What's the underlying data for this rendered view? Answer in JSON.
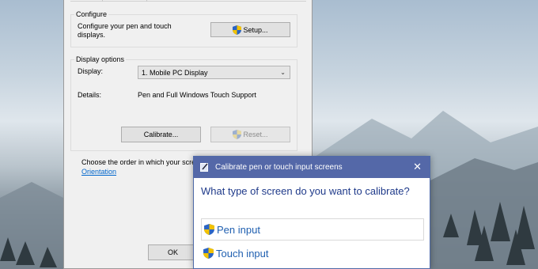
{
  "dialog": {
    "configure_group": "Configure",
    "configure_text": "Configure your pen and touch displays.",
    "setup_button": "Setup...",
    "display_options_group": "Display options",
    "display_label": "Display:",
    "display_value": "1. Mobile PC Display",
    "details_label": "Details:",
    "details_value": "Pen and Full Windows Touch Support",
    "calibrate_button": "Calibrate...",
    "reset_button": "Reset...",
    "order_text": "Choose the order in which your scre",
    "orientation_link": "Orientation",
    "ok_button": "OK"
  },
  "popup": {
    "title": "Calibrate pen or touch input screens",
    "question": "What type of screen do you want to calibrate?",
    "options": [
      "Pen input",
      "Touch input"
    ]
  },
  "colors": {
    "popup_titlebar": "#5468a8",
    "link": "#0066cc",
    "option_text": "#1f5fb0"
  },
  "icons": {
    "uac_shield": "shield-icon",
    "close": "close-icon",
    "dropdown": "chevron-down-icon"
  }
}
